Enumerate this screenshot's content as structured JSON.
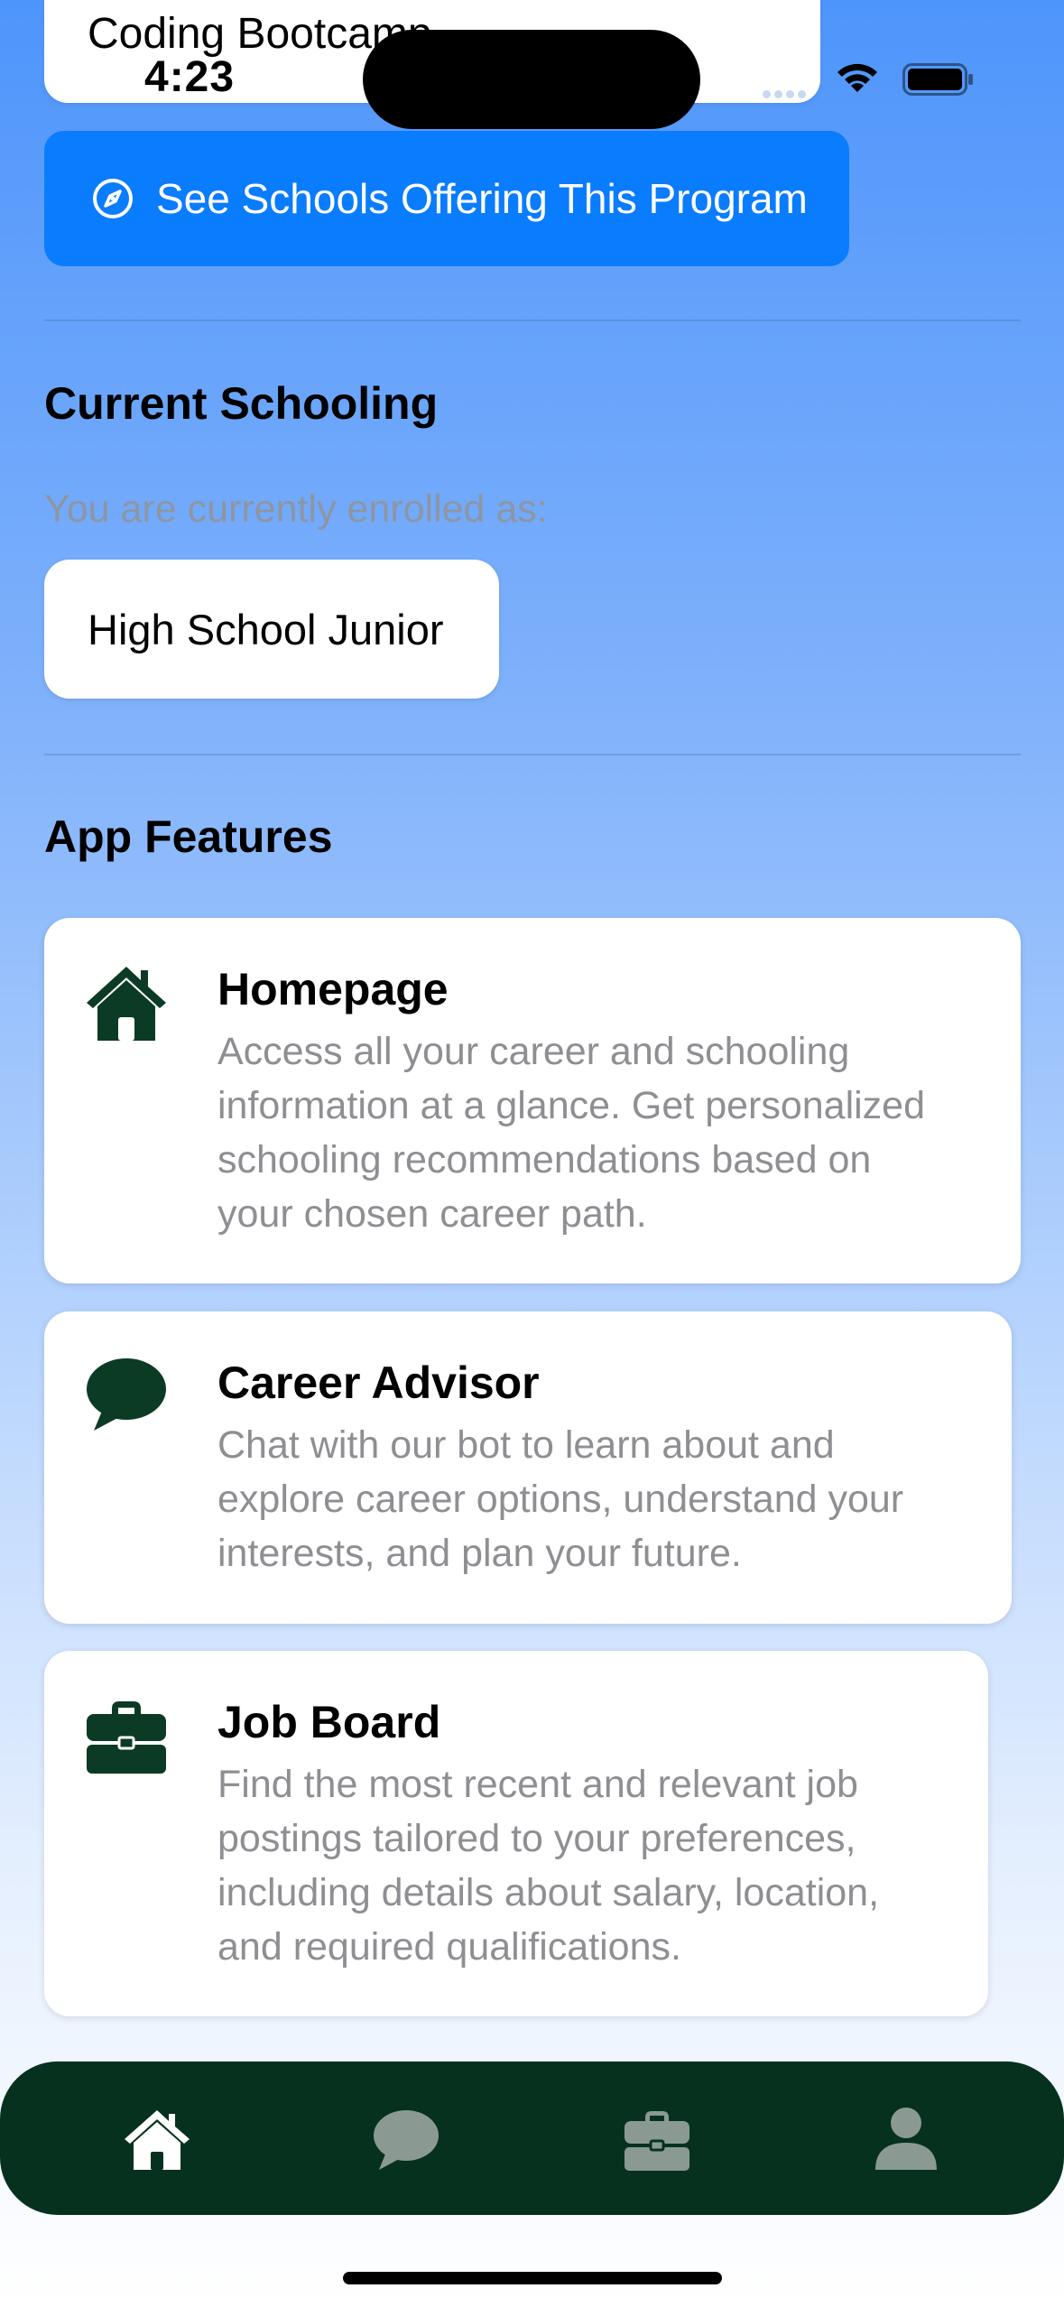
{
  "status_bar": {
    "time": "4:23"
  },
  "top_card": {
    "title": "Coding Bootcamp"
  },
  "schools_button": {
    "label": "See Schools Offering This Program",
    "icon": "compass-icon"
  },
  "current_schooling": {
    "title": "Current Schooling",
    "caption": "You are currently enrolled as:",
    "value": "High School Junior"
  },
  "app_features": {
    "title": "App Features",
    "items": [
      {
        "icon": "house-icon",
        "title": "Homepage",
        "line1": "Access all your career and schooling",
        "line2": "information at a glance. Get personalized",
        "line3": "schooling recommendations based on",
        "line4": "your chosen career path."
      },
      {
        "icon": "chat-bubble-icon",
        "title": "Career Advisor",
        "line1": "Chat with our bot to learn about and",
        "line2": "explore career options, understand your",
        "line3": "interests, and plan your future."
      },
      {
        "icon": "briefcase-icon",
        "title": "Job Board",
        "line1": "Find the most recent and relevant job",
        "line2": "postings tailored to your preferences,",
        "line3": "including details about salary, location,",
        "line4": "and required qualifications."
      }
    ]
  },
  "tab_bar": {
    "tabs": [
      "home-tab",
      "career-advisor-tab",
      "job-board-tab",
      "profile-tab"
    ],
    "active_color": "#ffffff",
    "inactive_color": "#8a9a92"
  },
  "colors": {
    "accent": "#0a7cfe",
    "brand_dark": "#07311f",
    "icon_green": "#0b3b24"
  }
}
